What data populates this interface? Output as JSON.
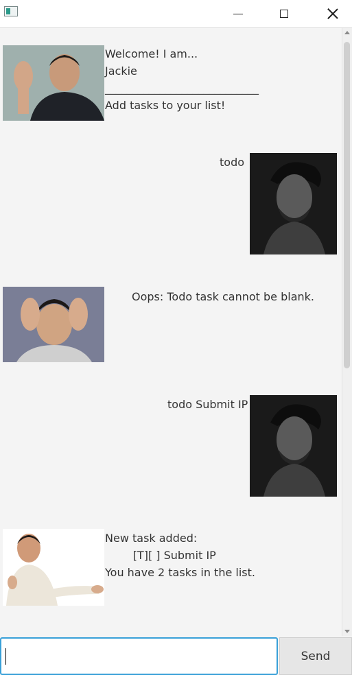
{
  "window": {
    "minimize_icon": "minimize-icon",
    "maximize_icon": "maximize-icon",
    "close_icon": "close-icon"
  },
  "messages": [
    {
      "sender": "bot",
      "lines": [
        "Welcome! I am...",
        "Jackie",
        "____________________________",
        "Add tasks to your list!"
      ]
    },
    {
      "sender": "user",
      "text": "todo"
    },
    {
      "sender": "bot",
      "text": "Oops: Todo task cannot be blank."
    },
    {
      "sender": "user",
      "text": "todo Submit IP"
    },
    {
      "sender": "bot",
      "lines": [
        "New task added:",
        "        [T][ ] Submit IP",
        "You have 2 tasks in the list."
      ]
    }
  ],
  "input": {
    "value": "",
    "placeholder": ""
  },
  "send_button": {
    "label": "Send"
  },
  "colors": {
    "focus_border": "#39a0d8",
    "background": "#f4f4f4"
  }
}
